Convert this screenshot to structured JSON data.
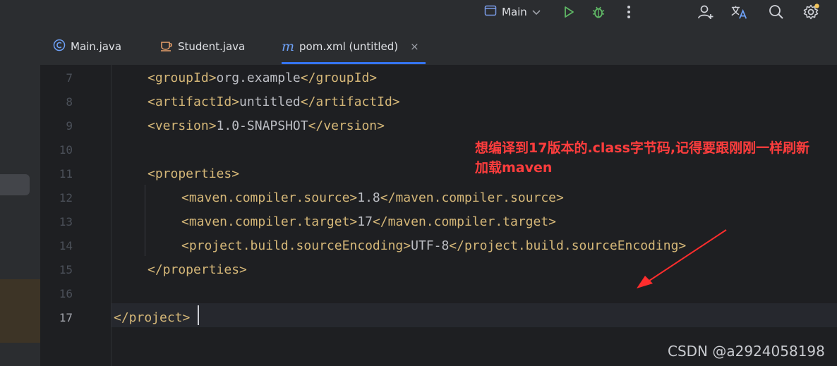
{
  "toolbar": {
    "run_config_label": "Main",
    "icons": [
      "window-icon",
      "chevron-down-icon",
      "run-icon",
      "debug-icon",
      "more-icon",
      "add-user-icon",
      "translate-icon",
      "search-icon",
      "settings-icon"
    ]
  },
  "tabs": [
    {
      "label": "Main.java",
      "icon": "class-icon"
    },
    {
      "label": "Student.java",
      "icon": "coffee-icon"
    },
    {
      "label": "pom.xml (untitled)",
      "icon": "maven-icon",
      "active": true,
      "close": "×"
    }
  ],
  "editor": {
    "line_numbers": [
      "7",
      "8",
      "9",
      "10",
      "11",
      "12",
      "13",
      "14",
      "15",
      "16",
      "17"
    ],
    "current_line": "17",
    "lines": [
      {
        "open": "<groupId>",
        "value": "org.example",
        "close": "</groupId>"
      },
      {
        "open": "<artifactId>",
        "value": "untitled",
        "close": "</artifactId>"
      },
      {
        "open": "<version>",
        "value": "1.0-SNAPSHOT",
        "close": "</version>"
      },
      {
        "open": "",
        "value": "",
        "close": ""
      },
      {
        "open": "<properties>",
        "value": "",
        "close": ""
      },
      {
        "open": "<maven.compiler.source>",
        "value": "1.8",
        "close": "</maven.compiler.source>"
      },
      {
        "open": "<maven.compiler.target>",
        "value": "17",
        "close": "</maven.compiler.target>"
      },
      {
        "open": "<project.build.sourceEncoding>",
        "value": "UTF-8",
        "close": "</project.build.sourceEncoding>"
      },
      {
        "open": "</properties>",
        "value": "",
        "close": ""
      },
      {
        "open": "",
        "value": "",
        "close": ""
      },
      {
        "open": "</project>",
        "value": "",
        "close": ""
      }
    ]
  },
  "annotation": {
    "line1": "想编译到17版本的.class字节码,记得要跟刚刚一样刷新",
    "line2": "加载maven"
  },
  "watermark": "CSDN @a2924058198",
  "colors": {
    "toolbar_bg": "#2b2d30",
    "editor_bg": "#1e1f22",
    "tag": "#d5b778",
    "text": "#bcbec4",
    "accent": "#3574f0",
    "annotation": "#ff3d3d",
    "run_green": "#5fb865",
    "notification_dot": "#f2c55c"
  }
}
